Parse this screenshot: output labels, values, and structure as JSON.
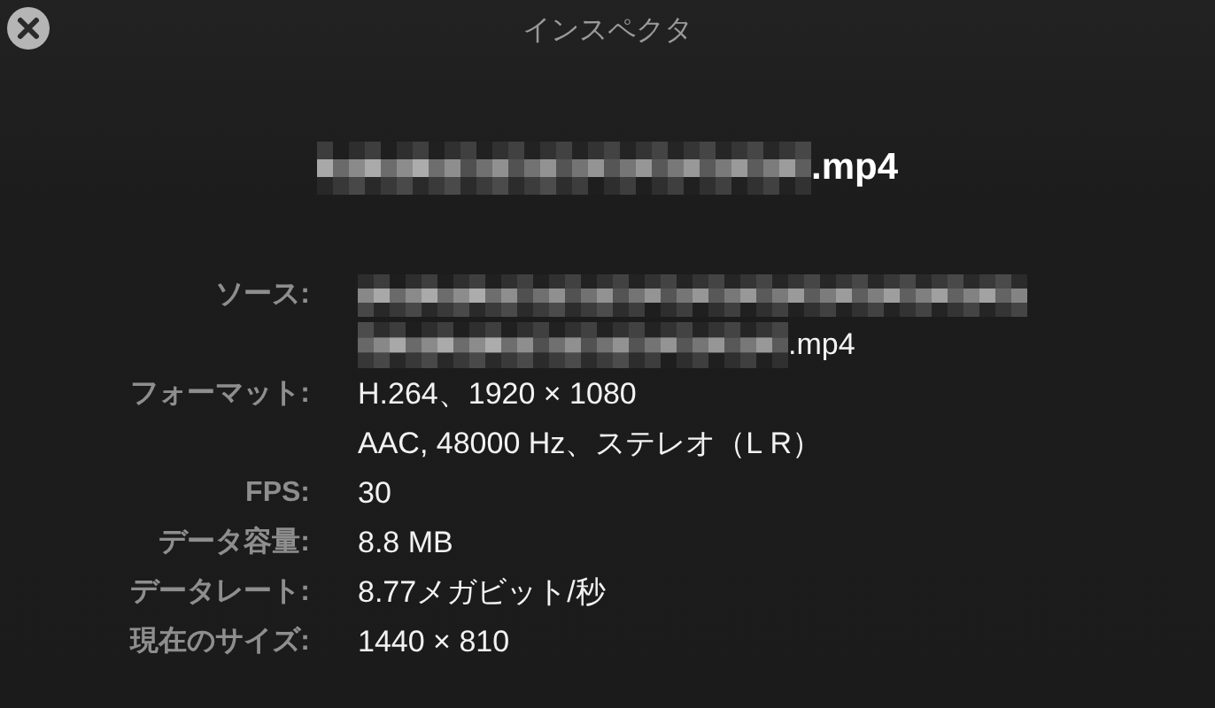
{
  "window": {
    "title": "インスペクタ"
  },
  "file": {
    "name_suffix": ".mp4"
  },
  "rows": [
    {
      "label": "ソース:",
      "lines": [
        {
          "redacted": true
        },
        {
          "redacted": true,
          "text": ".mp4"
        }
      ]
    },
    {
      "label": "フォーマット:",
      "lines": [
        {
          "redacted": false,
          "text": "H.264、1920 × 1080"
        },
        {
          "redacted": false,
          "text": "AAC, 48000 Hz、ステレオ（L R）"
        }
      ]
    },
    {
      "label": "FPS:",
      "lines": [
        {
          "redacted": false,
          "text": "30"
        }
      ]
    },
    {
      "label": "データ容量:",
      "lines": [
        {
          "redacted": false,
          "text": "8.8 MB"
        }
      ]
    },
    {
      "label": "データレート:",
      "lines": [
        {
          "redacted": false,
          "text": "8.77メガビット/秒"
        }
      ]
    },
    {
      "label": "現在のサイズ:",
      "lines": [
        {
          "redacted": false,
          "text": "1440 × 810"
        }
      ]
    }
  ]
}
